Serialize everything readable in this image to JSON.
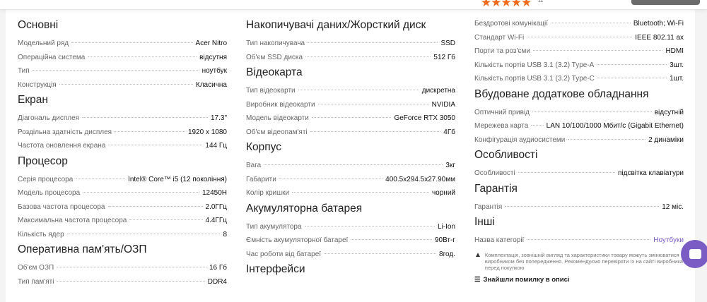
{
  "top": {
    "stars": "★★★★★",
    "review_count": "11"
  },
  "col1": [
    {
      "title": "Основні",
      "rows": [
        [
          "Модельний ряд",
          "Acer Nitro"
        ],
        [
          "Операційна система",
          "відсутня"
        ],
        [
          "Тип",
          "ноутбук"
        ],
        [
          "Конструкція",
          "Класична"
        ]
      ]
    },
    {
      "title": "Екран",
      "rows": [
        [
          "Діагональ дисплея",
          "17.3\""
        ],
        [
          "Роздільна здатність дисплея",
          "1920 x 1080"
        ],
        [
          "Частота оновлення екрана",
          "144 Гц"
        ]
      ]
    },
    {
      "title": "Процесор",
      "rows": [
        [
          "Серія процесора",
          "Intel® Core™ i5 (12 покоління)"
        ],
        [
          "Модель процесора",
          "12450H"
        ],
        [
          "Базова частота процесора",
          "2.0ГГц"
        ],
        [
          "Максимальна частота процесора",
          "4.4ГГц"
        ],
        [
          "Кількість ядер",
          "8"
        ]
      ]
    },
    {
      "title": "Оперативна пам'ять/ОЗП",
      "rows": [
        [
          "Об'єм ОЗП",
          "16 Гб"
        ],
        [
          "Тип пам'яті",
          "DDR4"
        ]
      ]
    }
  ],
  "col2": [
    {
      "title": "Накопичувачі даних/Жорсткий диск",
      "rows": [
        [
          "Тип накопичувача",
          "SSD"
        ],
        [
          "Об'єм SSD диска",
          "512 Гб"
        ]
      ]
    },
    {
      "title": "Відеокарта",
      "rows": [
        [
          "Тип відеокарти",
          "дискретна"
        ],
        [
          "Виробник відеокарти",
          "NVIDIA"
        ],
        [
          "Модель відеокарти",
          "GeForce RTX 3050"
        ],
        [
          "Об'єм відеопам'яті",
          "4Гб"
        ]
      ]
    },
    {
      "title": "Корпус",
      "rows": [
        [
          "Вага",
          "3кг"
        ],
        [
          "Габарити",
          "400.5x294.5x27.90мм"
        ],
        [
          "Колір кришки",
          "чорний"
        ]
      ]
    },
    {
      "title": "Акумуляторна батарея",
      "rows": [
        [
          "Тип акумулятора",
          "Li-Ion"
        ],
        [
          "Ємність акумуляторної батареї",
          "90Вт-г"
        ],
        [
          "Час роботи від батареї",
          "8год."
        ]
      ]
    },
    {
      "title": "Інтерфейси",
      "rows": []
    }
  ],
  "col3": [
    {
      "title": "",
      "rows": [
        [
          "Бездротові комунікації",
          "Bluetooth; Wi-Fi"
        ],
        [
          "Стандарт Wi-Fi",
          "IEEE 802.11 ax"
        ],
        [
          "Порти та роз'єми",
          "HDMI"
        ],
        [
          "Кількість портів USB 3.1 (3.2) Type-A",
          "3шт."
        ],
        [
          "Кількість портів USB 3.1 (3.2) Type-C",
          "1шт."
        ]
      ]
    },
    {
      "title": "Вбудоване додаткове обладнання",
      "rows": [
        [
          "Оптичний привід",
          "відсутній"
        ],
        [
          "Мережева карта",
          "LAN 10/100/1000 Мбит/с (Gigabit Ethernet)"
        ],
        [
          "Конфігурація аудиосистеми",
          "2 динаміки"
        ]
      ]
    },
    {
      "title": "Особливості",
      "rows": [
        [
          "Особливості",
          "підсвітка клавіатури"
        ]
      ]
    },
    {
      "title": "Гарантія",
      "rows": [
        [
          "Гарантія",
          "12 міс."
        ]
      ]
    },
    {
      "title": "Інші",
      "rows": [
        [
          "Назва категорії",
          "Ноутбуки"
        ]
      ]
    }
  ],
  "note": "Комплектація, зовнішній вигляд та характеристики товару можуть змінюватися виробником без попередження. Рекомендуємо перевіряти їх на сайті виробника перед покупкою",
  "error_link": "Знайшли помилку в описі",
  "colors": {
    "accent": "#7b5cc4",
    "stars": "#f26b1d"
  }
}
